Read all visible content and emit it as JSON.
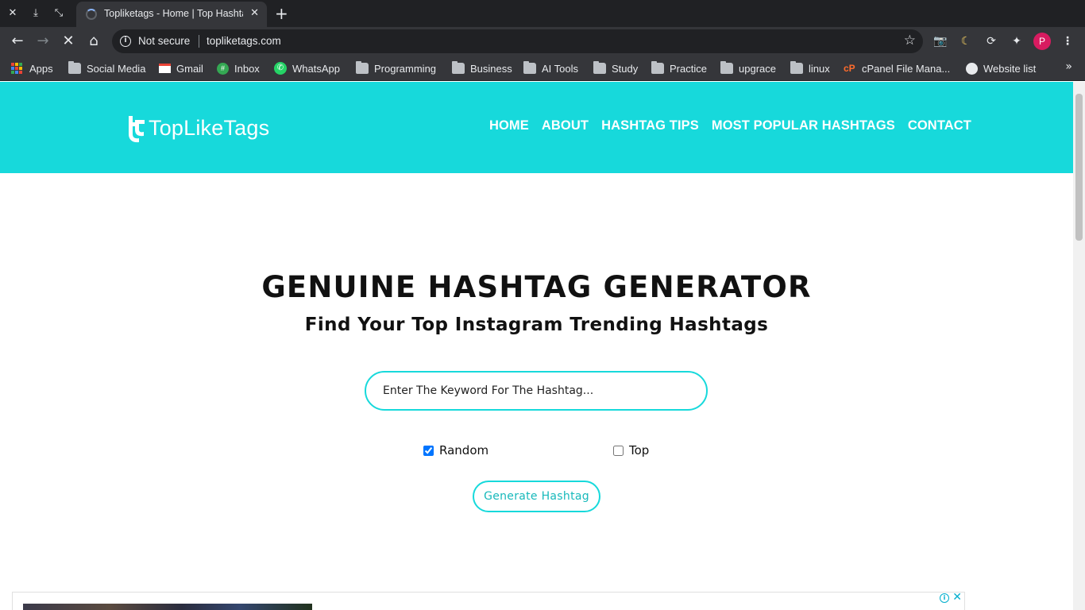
{
  "browser": {
    "tab_title": "Topliketags - Home | Top Hashtags",
    "address_security": "Not secure",
    "url": "topliketags.com",
    "profile_initial": "P",
    "bookmarks": [
      {
        "label": "Apps",
        "icon": "apps-grid-icon"
      },
      {
        "label": "Social Media",
        "icon": "folder-icon"
      },
      {
        "label": "Gmail",
        "icon": "gmail-icon"
      },
      {
        "label": "Inbox",
        "icon": "inbox-icon"
      },
      {
        "label": "WhatsApp",
        "icon": "whatsapp-icon"
      },
      {
        "label": "Programming",
        "icon": "folder-icon"
      },
      {
        "label": "Business",
        "icon": "folder-icon"
      },
      {
        "label": "AI Tools",
        "icon": "folder-icon"
      },
      {
        "label": "Study",
        "icon": "folder-icon"
      },
      {
        "label": "Practice",
        "icon": "folder-icon"
      },
      {
        "label": "upgrace",
        "icon": "folder-icon"
      },
      {
        "label": "linux",
        "icon": "folder-icon"
      },
      {
        "label": "cPanel File Mana...",
        "icon": "cpanel-icon"
      },
      {
        "label": "Website list",
        "icon": "globe-icon"
      }
    ]
  },
  "site": {
    "logo_text": "TopLikeTags",
    "nav": [
      "HOME",
      "ABOUT",
      "HASHTAG TIPS",
      "MOST POPULAR HASHTAGS",
      "CONTACT"
    ],
    "brand_color": "#17d9db"
  },
  "hero": {
    "title": "GENUINE HASHTAG GENERATOR",
    "subtitle": "Find Your Top Instagram Trending Hashtags"
  },
  "form": {
    "search_placeholder": "Enter The Keyword For The Hashtag...",
    "options": [
      {
        "label": "Random",
        "checked": true
      },
      {
        "label": "Top",
        "checked": false
      }
    ],
    "submit_label": "Generate Hashtag"
  }
}
